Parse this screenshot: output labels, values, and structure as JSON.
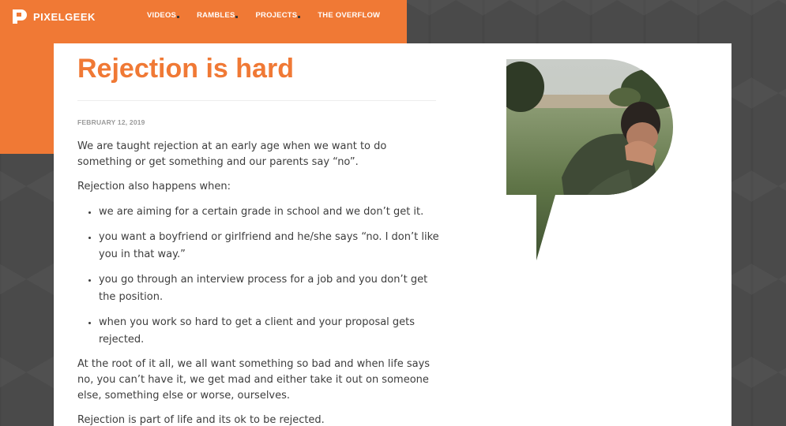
{
  "brand": {
    "name": "PIXELGEEK"
  },
  "nav": {
    "items": [
      {
        "label": "VIDEOS",
        "has_dropdown": true
      },
      {
        "label": "RAMBLES",
        "has_dropdown": true
      },
      {
        "label": "PROJECTS",
        "has_dropdown": true
      },
      {
        "label": "THE OVERFLOW",
        "has_dropdown": false
      }
    ]
  },
  "post": {
    "title": "Rejection is hard",
    "date": "FEBRUARY 12, 2019",
    "intro": "We are taught rejection at an early age when we want to do something or get something and our parents say “no”.",
    "lead": "Rejection also happens when:",
    "bullets": [
      "we are aiming for a certain grade in school and we don’t get it.",
      "you want a boyfriend or girlfriend and he/she says “no. I don’t like you in that way.”",
      "you go through an interview process for a job and you don’t get the position.",
      "when you work so hard to get a client and your proposal gets rejected."
    ],
    "paragraph2": "At the root of it all, we all want something so bad and when life says no, you can’t have it, we get mad and either take it out on someone else, something else or worse, ourselves.",
    "paragraph3": "Rejection is part of life and its ok to be rejected."
  },
  "colors": {
    "accent": "#f07935",
    "background": "#4a4a4a",
    "card": "#ffffff",
    "text": "#3d3d3d"
  },
  "image": {
    "icon": "pixelgeek-p-shape-photo"
  }
}
